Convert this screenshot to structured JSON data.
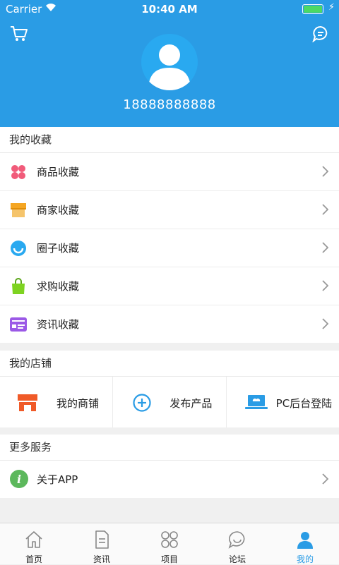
{
  "status_bar": {
    "carrier": "Carrier",
    "time": "10:40 AM"
  },
  "header": {
    "phone": "18888888888",
    "icons": [
      "cart-icon",
      "chat-icon",
      "avatar-icon"
    ]
  },
  "favorites": {
    "title": "我的收藏",
    "items": [
      {
        "label": "商品收藏",
        "icon": "clover-icon",
        "color": "#f15b7a"
      },
      {
        "label": "商家收藏",
        "icon": "store-icon",
        "color": "#f5a623"
      },
      {
        "label": "圈子收藏",
        "icon": "smile-icon",
        "color": "#29a9f0"
      },
      {
        "label": "求购收藏",
        "icon": "bag-icon",
        "color": "#7ed321"
      },
      {
        "label": "资讯收藏",
        "icon": "card-icon",
        "color": "#9b59e6"
      }
    ]
  },
  "shop": {
    "title": "我的店铺",
    "items": [
      {
        "label": "我的商铺",
        "icon": "shop-icon",
        "color": "#f05a28"
      },
      {
        "label": "发布产品",
        "icon": "plus-circle-icon",
        "color": "#2a9ce5"
      },
      {
        "label": "PC后台登陆",
        "icon": "laptop-icon",
        "color": "#2a9ce5"
      }
    ]
  },
  "services": {
    "title": "更多服务",
    "items": [
      {
        "label": "关于APP",
        "icon": "info-icon",
        "color": "#5cb85c"
      }
    ]
  },
  "tabs": [
    {
      "label": "首页",
      "icon": "home-icon"
    },
    {
      "label": "资讯",
      "icon": "document-icon"
    },
    {
      "label": "项目",
      "icon": "grid-icon"
    },
    {
      "label": "论坛",
      "icon": "bubble-icon"
    },
    {
      "label": "我的",
      "icon": "person-icon",
      "active": true
    }
  ]
}
